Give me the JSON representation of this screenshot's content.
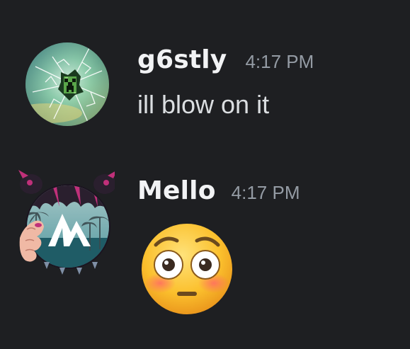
{
  "messages": [
    {
      "username": "g6stly",
      "timestamp": "4:17 PM",
      "content": "ill blow on it",
      "avatar_icon": "creeper-cracked-glass-avatar"
    },
    {
      "username": "Mello",
      "timestamp": "4:17 PM",
      "emoji": "flushed-face-emoji",
      "avatar_icon": "anime-girl-mountain-logo-avatar"
    }
  ],
  "colors": {
    "background": "#1e1f22",
    "username": "#f2f3f5",
    "timestamp": "#949ba4",
    "message_text": "#dbdee1"
  }
}
